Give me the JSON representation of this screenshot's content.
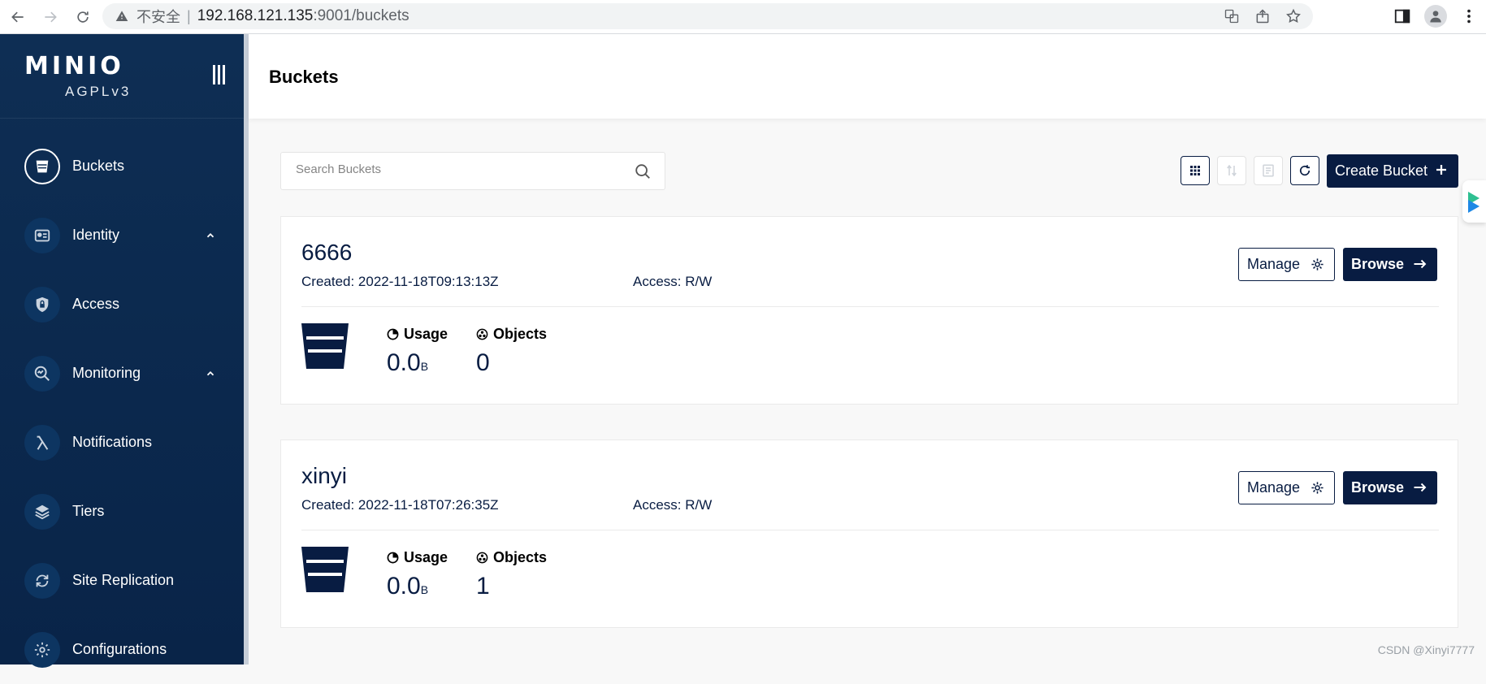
{
  "browser": {
    "insecure_label": "不安全",
    "url_host": "192.168.121.135",
    "url_path": ":9001/buckets"
  },
  "sidebar": {
    "logo": "MINIO",
    "license": "AGPLv3",
    "items": [
      {
        "label": "Buckets",
        "icon": "bucket-icon",
        "active": true
      },
      {
        "label": "Identity",
        "icon": "identity-card-icon",
        "expandable": true
      },
      {
        "label": "Access",
        "icon": "lock-shield-icon"
      },
      {
        "label": "Monitoring",
        "icon": "monitoring-search-icon",
        "expandable": true
      },
      {
        "label": "Notifications",
        "icon": "lambda-icon"
      },
      {
        "label": "Tiers",
        "icon": "layers-icon"
      },
      {
        "label": "Site Replication",
        "icon": "replication-icon"
      },
      {
        "label": "Configurations",
        "icon": "gear-icon"
      }
    ]
  },
  "header": {
    "title": "Buckets"
  },
  "toolbar": {
    "search_placeholder": "Search Buckets",
    "create_label": "Create Bucket"
  },
  "buckets": [
    {
      "name": "6666",
      "created": "Created: 2022-11-18T09:13:13Z",
      "access": "Access: R/W",
      "manage_label": "Manage",
      "browse_label": "Browse",
      "usage_label": "Usage",
      "usage_value": "0.0",
      "usage_unit": "B",
      "objects_label": "Objects",
      "objects_value": "0"
    },
    {
      "name": "xinyi",
      "created": "Created: 2022-11-18T07:26:35Z",
      "access": "Access: R/W",
      "manage_label": "Manage",
      "browse_label": "Browse",
      "usage_label": "Usage",
      "usage_value": "0.0",
      "usage_unit": "B",
      "objects_label": "Objects",
      "objects_value": "1"
    }
  ],
  "watermark": "CSDN @Xinyi7777",
  "colors": {
    "brand_dark": "#081c42",
    "sidebar_bg": "#0e2e54"
  }
}
